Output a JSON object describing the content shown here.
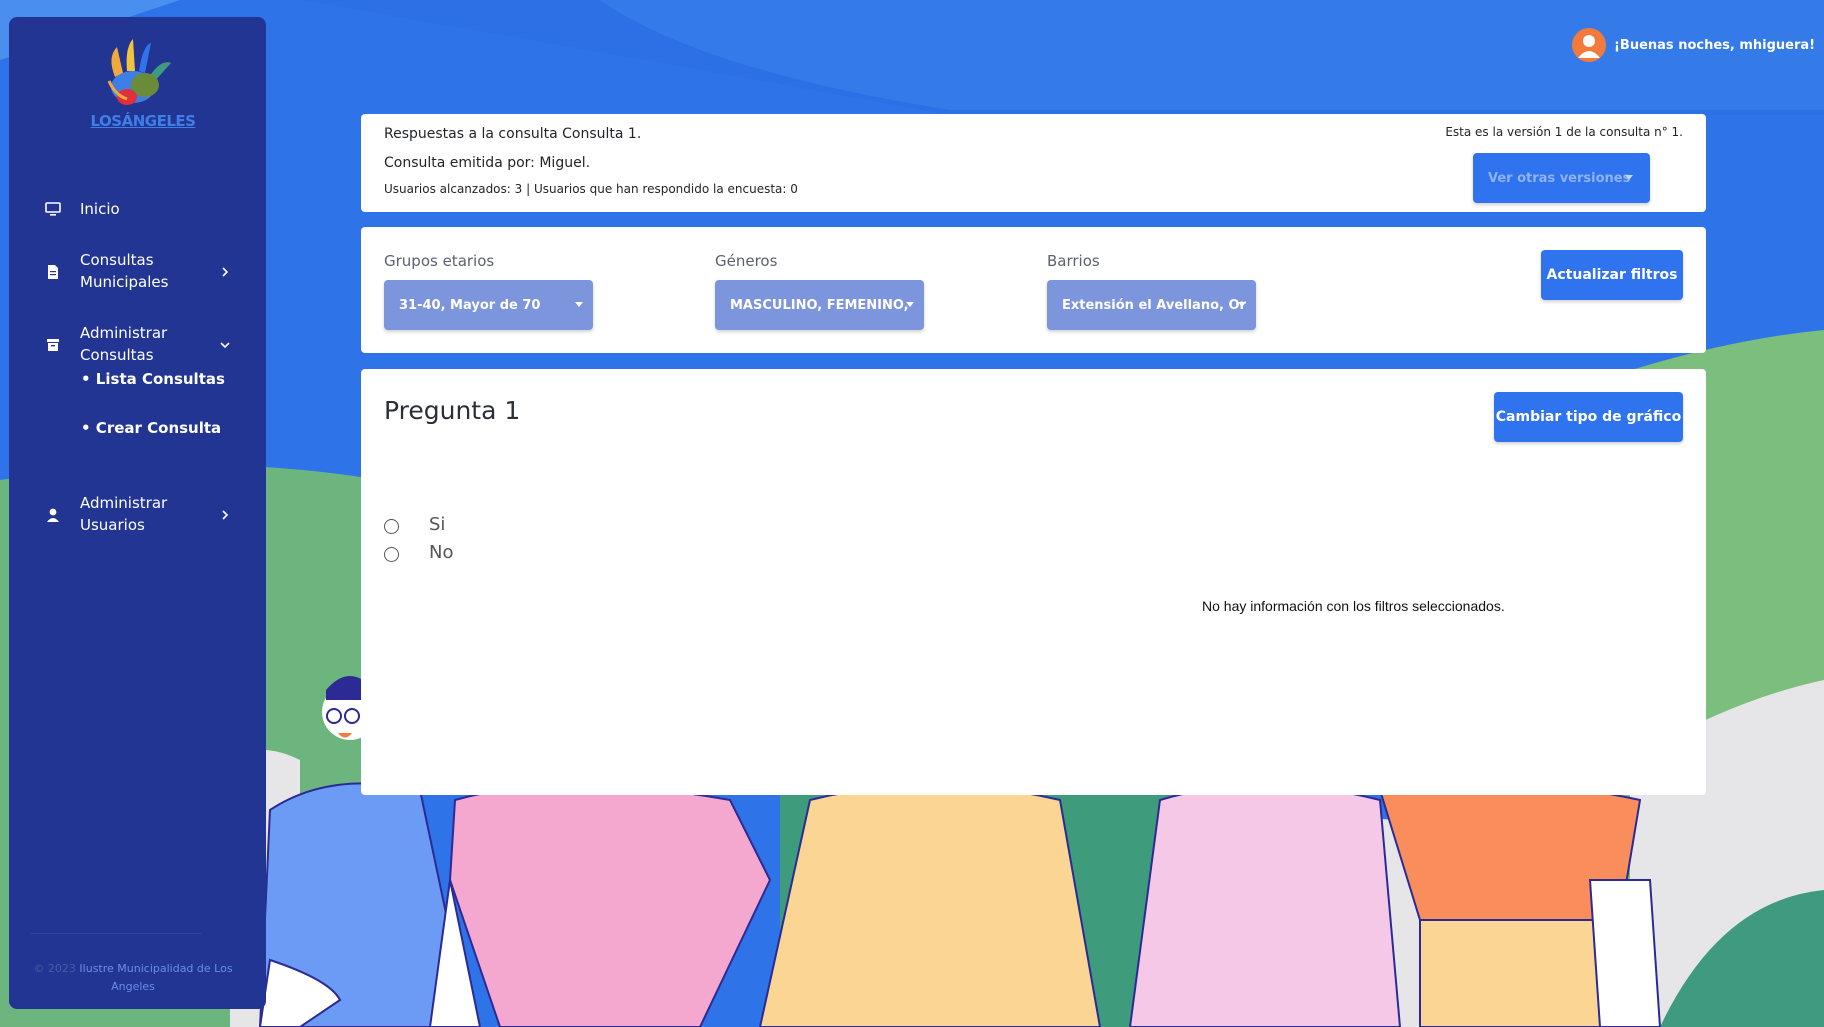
{
  "sidebar": {
    "logo_text": "LOSÁNGELES",
    "items": [
      {
        "label": "Inicio",
        "icon": "monitor-icon"
      },
      {
        "label": "Consultas Municipales",
        "icon": "document-icon"
      },
      {
        "label": "Administrar Consultas",
        "icon": "archive-box-icon"
      },
      {
        "label": "Administrar Usuarios",
        "icon": "user-icon"
      }
    ],
    "subitems": [
      "• Lista Consultas",
      "• Crear Consulta"
    ],
    "copyright_prefix": "© 2023",
    "copyright_name": "Ilustre Municipalidad de Los Angeles"
  },
  "header": {
    "greeting": "¡Buenas noches, mhiguera!"
  },
  "summary": {
    "title": "Respuestas a la consulta Consulta 1.",
    "issuer": "Consulta emitida por: Miguel.",
    "stats": "Usuarios alcanzados: 3 | Usuarios que han respondido la encuesta: 0",
    "version_text": "Esta es la versión 1 de la consulta n° 1.",
    "versions_dropdown": "Ver otras versiones"
  },
  "filters": {
    "age_label": "Grupos etarios",
    "age_value": "31-40, Mayor de 70",
    "gender_label": "Géneros",
    "gender_value": "MASCULINO, FEMENINO,",
    "barrio_label": "Barrios",
    "barrio_value": "Extensión el Avellano, Or",
    "update_button": "Actualizar filtros"
  },
  "question": {
    "title": "Pregunta 1",
    "chart_button": "Cambiar tipo de gráfico",
    "options": [
      "Si",
      "No"
    ],
    "empty_message": "No hay información con los filtros seleccionados."
  },
  "colors": {
    "background_blue": "#2f73e8",
    "sidebar": "#223592",
    "primary_button": "#2f74ee",
    "filter_dropdown": "#7d95dc",
    "avatar": "#f27a3a"
  }
}
